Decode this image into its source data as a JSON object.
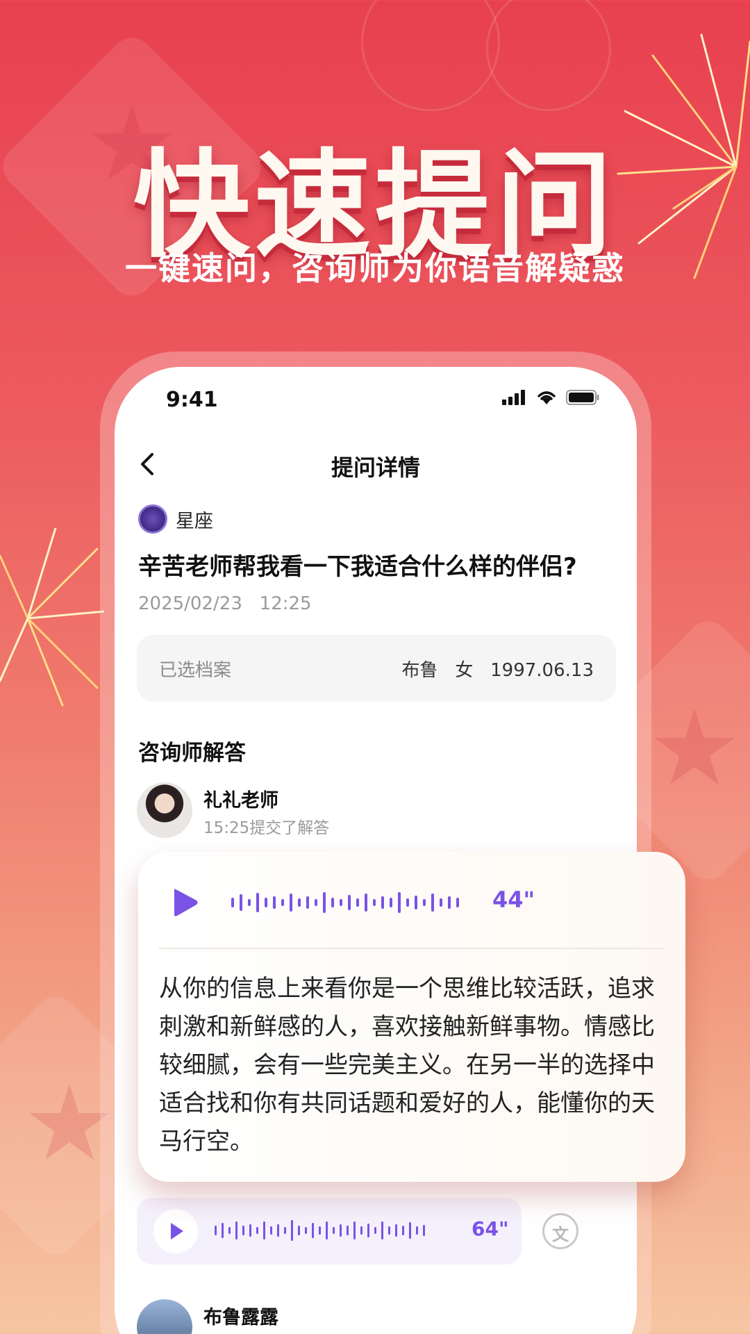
{
  "hero": {
    "title": "快速提问",
    "subtitle": "一键速问，咨询师为你语音解疑惑"
  },
  "status_bar": {
    "time": "9:41"
  },
  "nav": {
    "title": "提问详情"
  },
  "question": {
    "category": "星座",
    "text": "辛苦老师帮我看一下我适合什么样的伴侣?",
    "date": "2025/02/23   12:25"
  },
  "profile": {
    "label": "已选档案",
    "value": "布鲁   女   1997.06.13"
  },
  "answers": {
    "title": "咨询师解答",
    "teacher_name": "礼礼老师",
    "teacher_time": "15:25提交了解答",
    "voice1_duration": "44\"",
    "answer_text": "从你的信息上来看你是一个思维比较活跃，追求刺激和新鲜感的人，喜欢接触新鲜事物。情感比较细腻，会有一些完美主义。在另一半的选择中适合找和你有共同话题和爱好的人，能懂你的天马行空。",
    "voice2_duration": "64\""
  },
  "next_user": {
    "name": "布鲁露露"
  },
  "colors": {
    "accent_purple": "#7a52e6",
    "bg_red": "#e8404f"
  }
}
